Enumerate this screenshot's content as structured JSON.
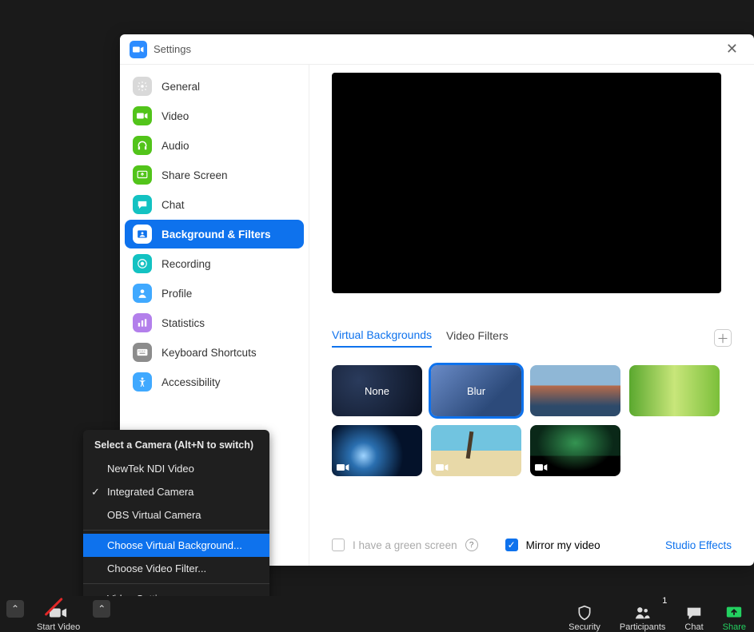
{
  "window": {
    "title": "Settings"
  },
  "sidebar": {
    "items": [
      {
        "key": "general",
        "label": "General",
        "color": "#d9d9d9"
      },
      {
        "key": "video",
        "label": "Video",
        "color": "#52c41a"
      },
      {
        "key": "audio",
        "label": "Audio",
        "color": "#52c41a"
      },
      {
        "key": "share-screen",
        "label": "Share Screen",
        "color": "#52c41a"
      },
      {
        "key": "chat",
        "label": "Chat",
        "color": "#13c2c2"
      },
      {
        "key": "background-filters",
        "label": "Background & Filters",
        "color": "#0e72ed",
        "active": true
      },
      {
        "key": "recording",
        "label": "Recording",
        "color": "#13c2c2"
      },
      {
        "key": "profile",
        "label": "Profile",
        "color": "#40a9ff"
      },
      {
        "key": "statistics",
        "label": "Statistics",
        "color": "#b37feb"
      },
      {
        "key": "keyboard-shortcuts",
        "label": "Keyboard Shortcuts",
        "color": "#8c8c8c"
      },
      {
        "key": "accessibility",
        "label": "Accessibility",
        "color": "#40a9ff"
      }
    ]
  },
  "tabs": {
    "virtual_backgrounds": "Virtual Backgrounds",
    "video_filters": "Video Filters"
  },
  "thumbs": {
    "none": "None",
    "blur": "Blur"
  },
  "footer": {
    "green_screen": "I have a green screen",
    "mirror": "Mirror my video",
    "studio": "Studio Effects"
  },
  "camera_menu": {
    "header": "Select a Camera (Alt+N to switch)",
    "cam1": "NewTek NDI Video",
    "cam2": "Integrated Camera",
    "cam3": "OBS Virtual Camera",
    "choose_bg": "Choose Virtual Background...",
    "choose_filter": "Choose Video Filter...",
    "video_settings": "Video Settings..."
  },
  "bottombar": {
    "start_video": "Start Video",
    "security": "Security",
    "participants": "Participants",
    "participants_count": "1",
    "chat": "Chat",
    "share": "Share"
  }
}
